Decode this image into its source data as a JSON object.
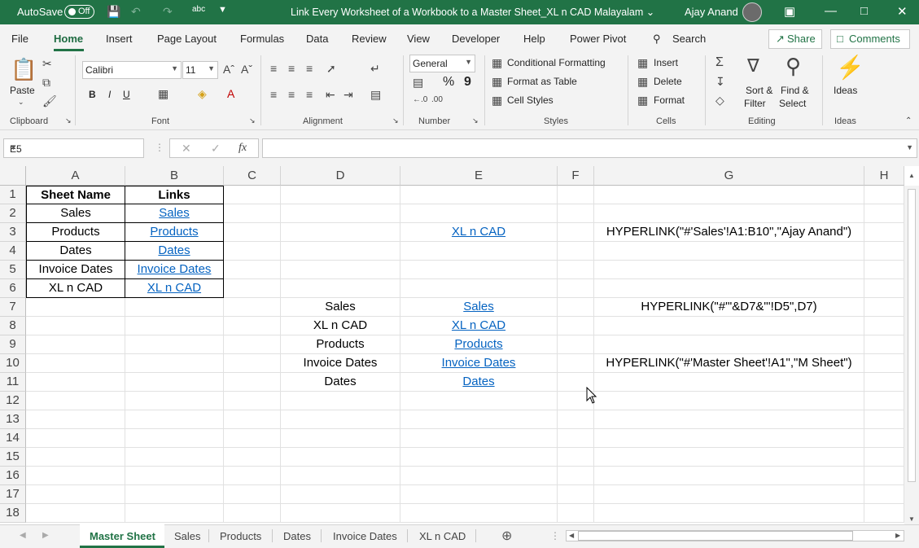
{
  "title_bar": {
    "autosave_label": "AutoSave",
    "toggle_state": "Off",
    "doc_title": "Link Every Worksheet of a Workbook to a Master Sheet_XL n CAD Malayalam",
    "title_dropdown": "⌄",
    "user_name": "Ajay Anand",
    "icons": [
      "save-icon",
      "undo-icon",
      "redo-icon",
      "spelling-icon",
      "customize-icon",
      "ribbon-display-icon",
      "minimize-icon",
      "maximize-icon",
      "close-icon"
    ]
  },
  "ribbon_tabs": [
    "File",
    "Home",
    "Insert",
    "Page Layout",
    "Formulas",
    "Data",
    "Review",
    "View",
    "Developer",
    "Help",
    "Power Pivot"
  ],
  "search_label": "Search",
  "share_label": "Share",
  "comments_label": "Comments",
  "ribbon": {
    "clipboard": {
      "paste": "Paste",
      "label": "Clipboard"
    },
    "font": {
      "name": "Calibri",
      "size": "11",
      "bold": "B",
      "italic": "I",
      "underline": "U",
      "label": "Font"
    },
    "alignment": {
      "label": "Alignment"
    },
    "number": {
      "format": "General",
      "percent": "%",
      "comma": "9",
      "label": "Number"
    },
    "styles": {
      "conditional": "Conditional Formatting",
      "format_table": "Format as Table",
      "cell_styles": "Cell Styles",
      "label": "Styles"
    },
    "cells": {
      "insert": "Insert",
      "delete": "Delete",
      "format": "Format",
      "label": "Cells"
    },
    "editing": {
      "sort1": "Sort &",
      "sort2": "Filter",
      "find1": "Find &",
      "find2": "Select",
      "label": "Editing"
    },
    "ideas": {
      "button": "Ideas",
      "label": "Ideas"
    }
  },
  "formula_bar": {
    "name_box": "E5",
    "fx": "fx",
    "cancel": "✕",
    "enter": "✓",
    "value": ""
  },
  "columns": [
    "A",
    "B",
    "C",
    "D",
    "E",
    "F",
    "G",
    "H"
  ],
  "rows": [
    "1",
    "2",
    "3",
    "4",
    "5",
    "6",
    "7",
    "8",
    "9",
    "10",
    "11",
    "12",
    "13",
    "14",
    "15",
    "16",
    "17",
    "18"
  ],
  "cells": {
    "A1": "Sheet Name",
    "B1": "Links",
    "A2": "Sales",
    "B2": "Sales",
    "A3": "Products",
    "B3": "Products",
    "A4": "Dates",
    "B4": "Dates",
    "A5": "Invoice Dates",
    "B5": "Invoice Dates",
    "A6": "XL n CAD",
    "B6": "XL n CAD",
    "E3": "XL n CAD",
    "G3": "HYPERLINK(\"#'Sales'!A1:B10\",\"Ajay Anand\")",
    "D7": "Sales",
    "E7": "Sales",
    "G7": "HYPERLINK(\"#'\"&D7&\"'!D5\",D7)",
    "D8": "XL n CAD",
    "E8": "XL n CAD",
    "D9": "Products",
    "E9": "Products",
    "D10": "Invoice Dates",
    "E10": "Invoice Dates",
    "G10": "HYPERLINK(\"#'Master Sheet'!A1\",\"M Sheet\")",
    "D11": "Dates",
    "E11": "Dates"
  },
  "sheet_tabs": [
    "Master Sheet",
    "Sales",
    "Products",
    "Dates",
    "Invoice Dates",
    "XL n CAD"
  ],
  "active_sheet": "Master Sheet",
  "colors": {
    "accent": "#217346",
    "link": "#0563c1"
  }
}
